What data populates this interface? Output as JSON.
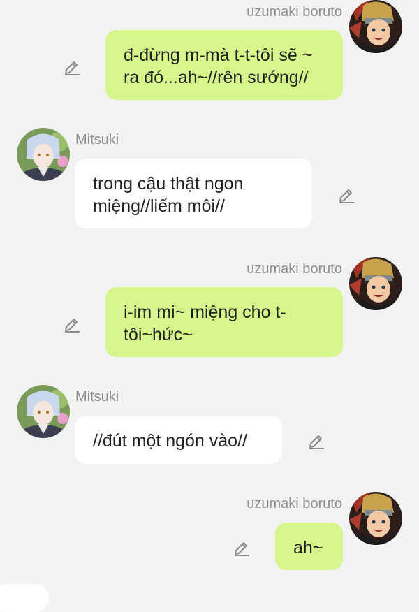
{
  "messages": [
    {
      "sender": "uzumaki boruto",
      "side": "right",
      "text": "đ-đừng m-mà t-t-tôi sẽ ~ ra đó...ah~//rên sướng//"
    },
    {
      "sender": "Mitsuki",
      "side": "left",
      "text": "trong cậu thật ngon miệng//liếm môi//"
    },
    {
      "sender": "uzumaki boruto",
      "side": "right",
      "text": "i-im mi~ miệng cho t-tôi~hức~"
    },
    {
      "sender": "Mitsuki",
      "side": "left",
      "text": "//đút một ngón vào//"
    },
    {
      "sender": "uzumaki boruto",
      "side": "right",
      "text": "ah~"
    }
  ],
  "colors": {
    "background": "#f2f2f2",
    "right_bubble": "#d6f58a",
    "left_bubble": "#ffffff",
    "name_text": "#8e8e8e",
    "edit_icon": "#8a8a8a"
  },
  "icons": {
    "edit": "pencil-edit-icon",
    "avatar_boruto": "avatar-boruto",
    "avatar_mitsuki": "avatar-mitsuki"
  }
}
